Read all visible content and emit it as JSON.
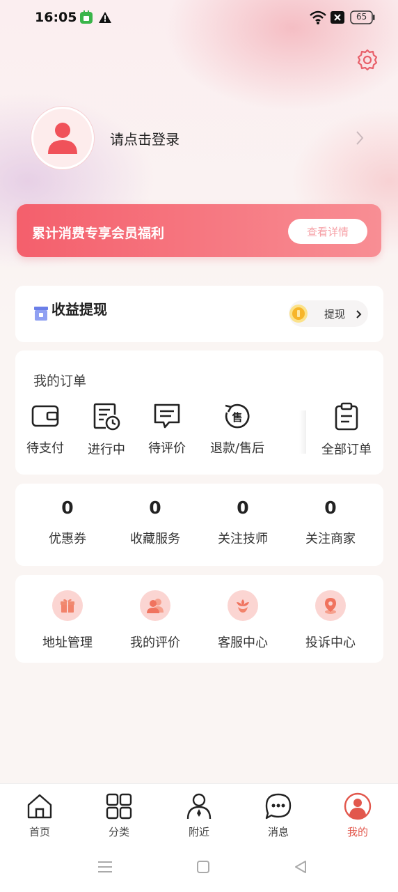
{
  "status_bar": {
    "time": "16:05",
    "battery": "65"
  },
  "profile": {
    "login_text": "请点击登录"
  },
  "vip_banner": {
    "title": "累计消费专享会员福利",
    "button": "查看详情"
  },
  "earnings": {
    "title": "收益提现",
    "withdraw_label": "提现"
  },
  "orders": {
    "title": "我的订单",
    "items": [
      {
        "label": "待支付",
        "icon": "wallet-icon"
      },
      {
        "label": "进行中",
        "icon": "document-clock-icon"
      },
      {
        "label": "待评价",
        "icon": "comment-icon"
      },
      {
        "label": "退款/售后",
        "icon": "refund-icon"
      },
      {
        "label": "全部订单",
        "icon": "clipboard-icon"
      }
    ]
  },
  "stats": [
    {
      "value": "0",
      "label": "优惠券"
    },
    {
      "value": "0",
      "label": "收藏服务"
    },
    {
      "value": "0",
      "label": "关注技师"
    },
    {
      "value": "0",
      "label": "关注商家"
    }
  ],
  "services": [
    {
      "label": "地址管理",
      "icon": "gift-icon"
    },
    {
      "label": "我的评价",
      "icon": "users-icon"
    },
    {
      "label": "客服中心",
      "icon": "flower-icon"
    },
    {
      "label": "投诉中心",
      "icon": "location-pin-icon"
    }
  ],
  "refund_icon_char": "售",
  "bottom_nav": [
    {
      "label": "首页",
      "icon": "home-icon"
    },
    {
      "label": "分类",
      "icon": "grid-icon"
    },
    {
      "label": "附近",
      "icon": "person-icon"
    },
    {
      "label": "消息",
      "icon": "chat-icon"
    },
    {
      "label": "我的",
      "icon": "profile-icon",
      "active": true
    }
  ],
  "colors": {
    "accent": "#e2574c",
    "banner_start": "#f45f6c",
    "banner_end": "#f88e94",
    "icon_circle": "#fbd5d2"
  }
}
